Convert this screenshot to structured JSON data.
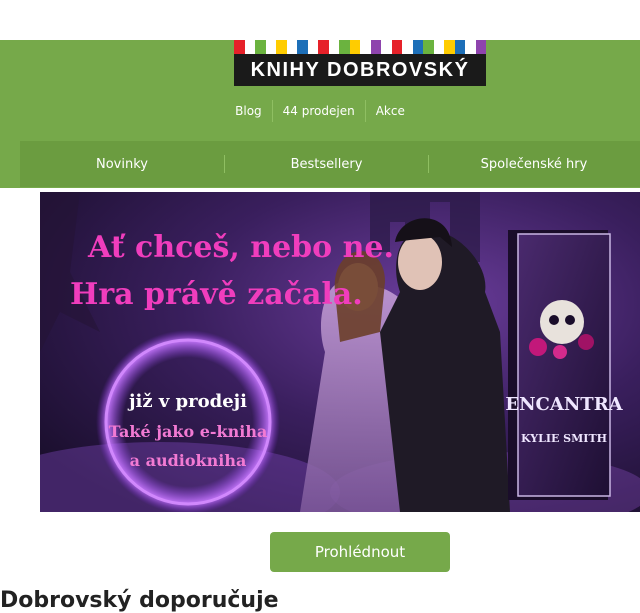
{
  "logo": {
    "text": "KNIHY DOBROVSKÝ",
    "stripe_colors": [
      "#e62129",
      "#ffffff",
      "#6bb33f",
      "#ffffff",
      "#ffcc00",
      "#ffffff",
      "#1d6fb8",
      "#ffffff",
      "#e62129",
      "#ffffff",
      "#6bb33f",
      "#ffcc00",
      "#ffffff",
      "#8e44ad",
      "#ffffff",
      "#e62129",
      "#ffffff",
      "#1d6fb8",
      "#6bb33f",
      "#ffffff",
      "#ffcc00",
      "#1d6fb8",
      "#ffffff",
      "#8e44ad"
    ]
  },
  "toplinks": [
    "Blog",
    "44 prodejen",
    "Akce"
  ],
  "nav": [
    "Novinky",
    "Bestsellery",
    "Společenské hry"
  ],
  "banner": {
    "headline_1": "Ať chceš, nebo ne.",
    "headline_2": "Hra právě začala.",
    "circle_line_1": "již v prodeji",
    "circle_line_2": "Také jako e-kniha",
    "circle_line_3": "a audiokniha",
    "book_title": "ENCANTRA",
    "book_author": "KYLIE SMITH"
  },
  "cta_label": "Prohlédnout",
  "section_title": "Dobrovský doporučuje",
  "colors": {
    "header_green": "#76a94a",
    "nav_green": "#6b9c40",
    "pink": "#f03dbd"
  }
}
